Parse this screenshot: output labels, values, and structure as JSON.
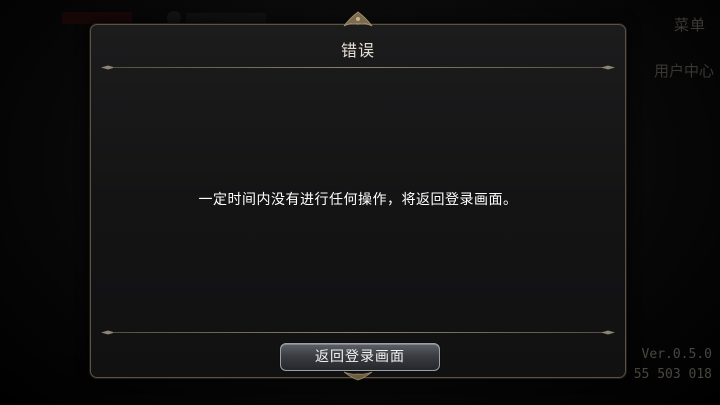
{
  "background": {
    "menu_label": "菜单",
    "user_center_label": "用户中心",
    "version_text": "Ver.0.5.0",
    "code_text": "55 503 018"
  },
  "dialog": {
    "title": "错误",
    "message": "一定时间内没有进行任何操作，将返回登录画面。",
    "return_button_label": "返回登录画面"
  },
  "colors": {
    "dialog_border": "#5b5244",
    "button_border": "#9aa0a8",
    "text": "#ffffff"
  }
}
